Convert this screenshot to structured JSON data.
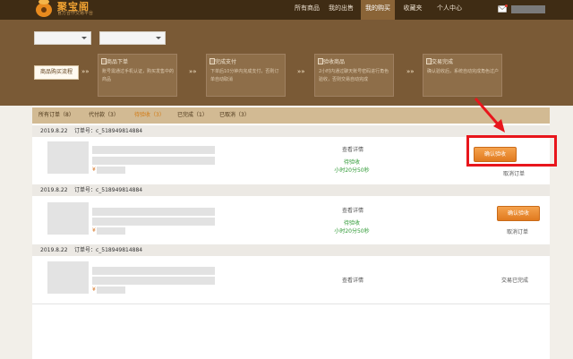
{
  "brand": {
    "name": "聚宝阁",
    "slogan": "官方合作交易平台"
  },
  "nav": {
    "items": [
      {
        "label": "所有商品"
      },
      {
        "label": "我的出售"
      },
      {
        "label": "我的购买"
      },
      {
        "label": "收藏夹"
      },
      {
        "label": "个人中心"
      }
    ],
    "active_index": 2
  },
  "banner": {
    "flow_label": "商品购买流程",
    "arrow": "»»",
    "steps": [
      {
        "title": "商品下单",
        "desc": "账号需通过手机认证，购买发售中的商品"
      },
      {
        "title": "完成支付",
        "desc": "下单后10分钟内完成支付，否则订单自动取消"
      },
      {
        "title": "验收商品",
        "desc": "2小时内通过聊天账号密码进行角色验收，否则交易自动完成"
      },
      {
        "title": "交易完成",
        "desc": "确认验收后，系统自动完成角色过户"
      }
    ]
  },
  "tabs": [
    {
      "label": "所有订单（8）"
    },
    {
      "label": "代付款（3）"
    },
    {
      "label": "待验收（3）"
    },
    {
      "label": "已完成（1）"
    },
    {
      "label": "已取消（3）"
    }
  ],
  "active_tab": 2,
  "orders": [
    {
      "date": "2019.8.22",
      "order_no": "订单号：c_518949814884",
      "yen": "¥",
      "detail": "查看详情",
      "status": "待验收",
      "countdown": "小时20分50秒",
      "button": "确认验收",
      "cancel": "取消订单"
    },
    {
      "date": "2019.8.22",
      "order_no": "订单号：c_518949814884",
      "yen": "¥",
      "detail": "查看详情",
      "status": "待验收",
      "countdown": "小时20分50秒",
      "button": "确认验收",
      "cancel": "取消订单"
    },
    {
      "date": "2019.8.22",
      "order_no": "订单号：c_518949814884",
      "yen": "¥",
      "detail": "查看详情",
      "done": "交易已完成"
    }
  ],
  "colors": {
    "topbar": "#3f2c14",
    "banner": "#7a5a36",
    "tab_bar": "#d2ba93",
    "accent": "#e07a1f",
    "status_green": "#2f9a35",
    "highlight": "#e8161c"
  }
}
